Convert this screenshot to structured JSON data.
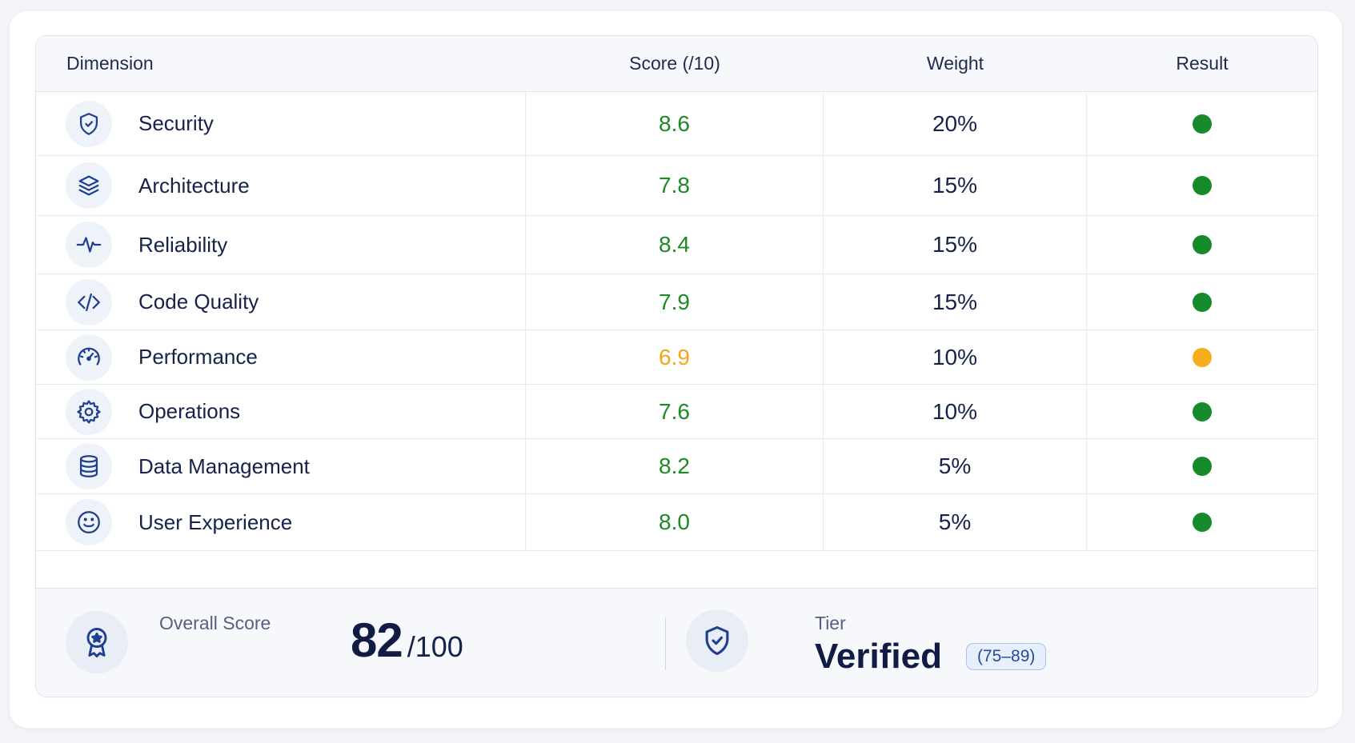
{
  "header": {
    "dimension": "Dimension",
    "score": "Score (/10)",
    "weight": "Weight",
    "result": "Result"
  },
  "rows": [
    {
      "icon": "shield-check-icon",
      "label": "Security",
      "score": "8.6",
      "weight": "20%",
      "status": "green"
    },
    {
      "icon": "layers-icon",
      "label": "Architecture",
      "score": "7.8",
      "weight": "15%",
      "status": "green"
    },
    {
      "icon": "pulse-icon",
      "label": "Reliability",
      "score": "8.4",
      "weight": "15%",
      "status": "green"
    },
    {
      "icon": "code-icon",
      "label": "Code Quality",
      "score": "7.9",
      "weight": "15%",
      "status": "green"
    },
    {
      "icon": "speedometer-icon",
      "label": "Performance",
      "score": "6.9",
      "weight": "10%",
      "status": "amber"
    },
    {
      "icon": "gear-icon",
      "label": "Operations",
      "score": "7.6",
      "weight": "10%",
      "status": "green"
    },
    {
      "icon": "database-icon",
      "label": "Data Management",
      "score": "8.2",
      "weight": "5%",
      "status": "green"
    },
    {
      "icon": "smiley-icon",
      "label": "User Experience",
      "score": "8.0",
      "weight": "5%",
      "status": "green"
    }
  ],
  "summary": {
    "overall_label": "Overall Score",
    "overall_value": "82",
    "overall_max": "/100",
    "tier_label": "Tier",
    "tier_value": "Verified",
    "tier_range": "(75–89)"
  },
  "colors": {
    "green": "#1d8a25",
    "amber": "#f0a51a",
    "icon_stroke": "#1f3f8f"
  }
}
